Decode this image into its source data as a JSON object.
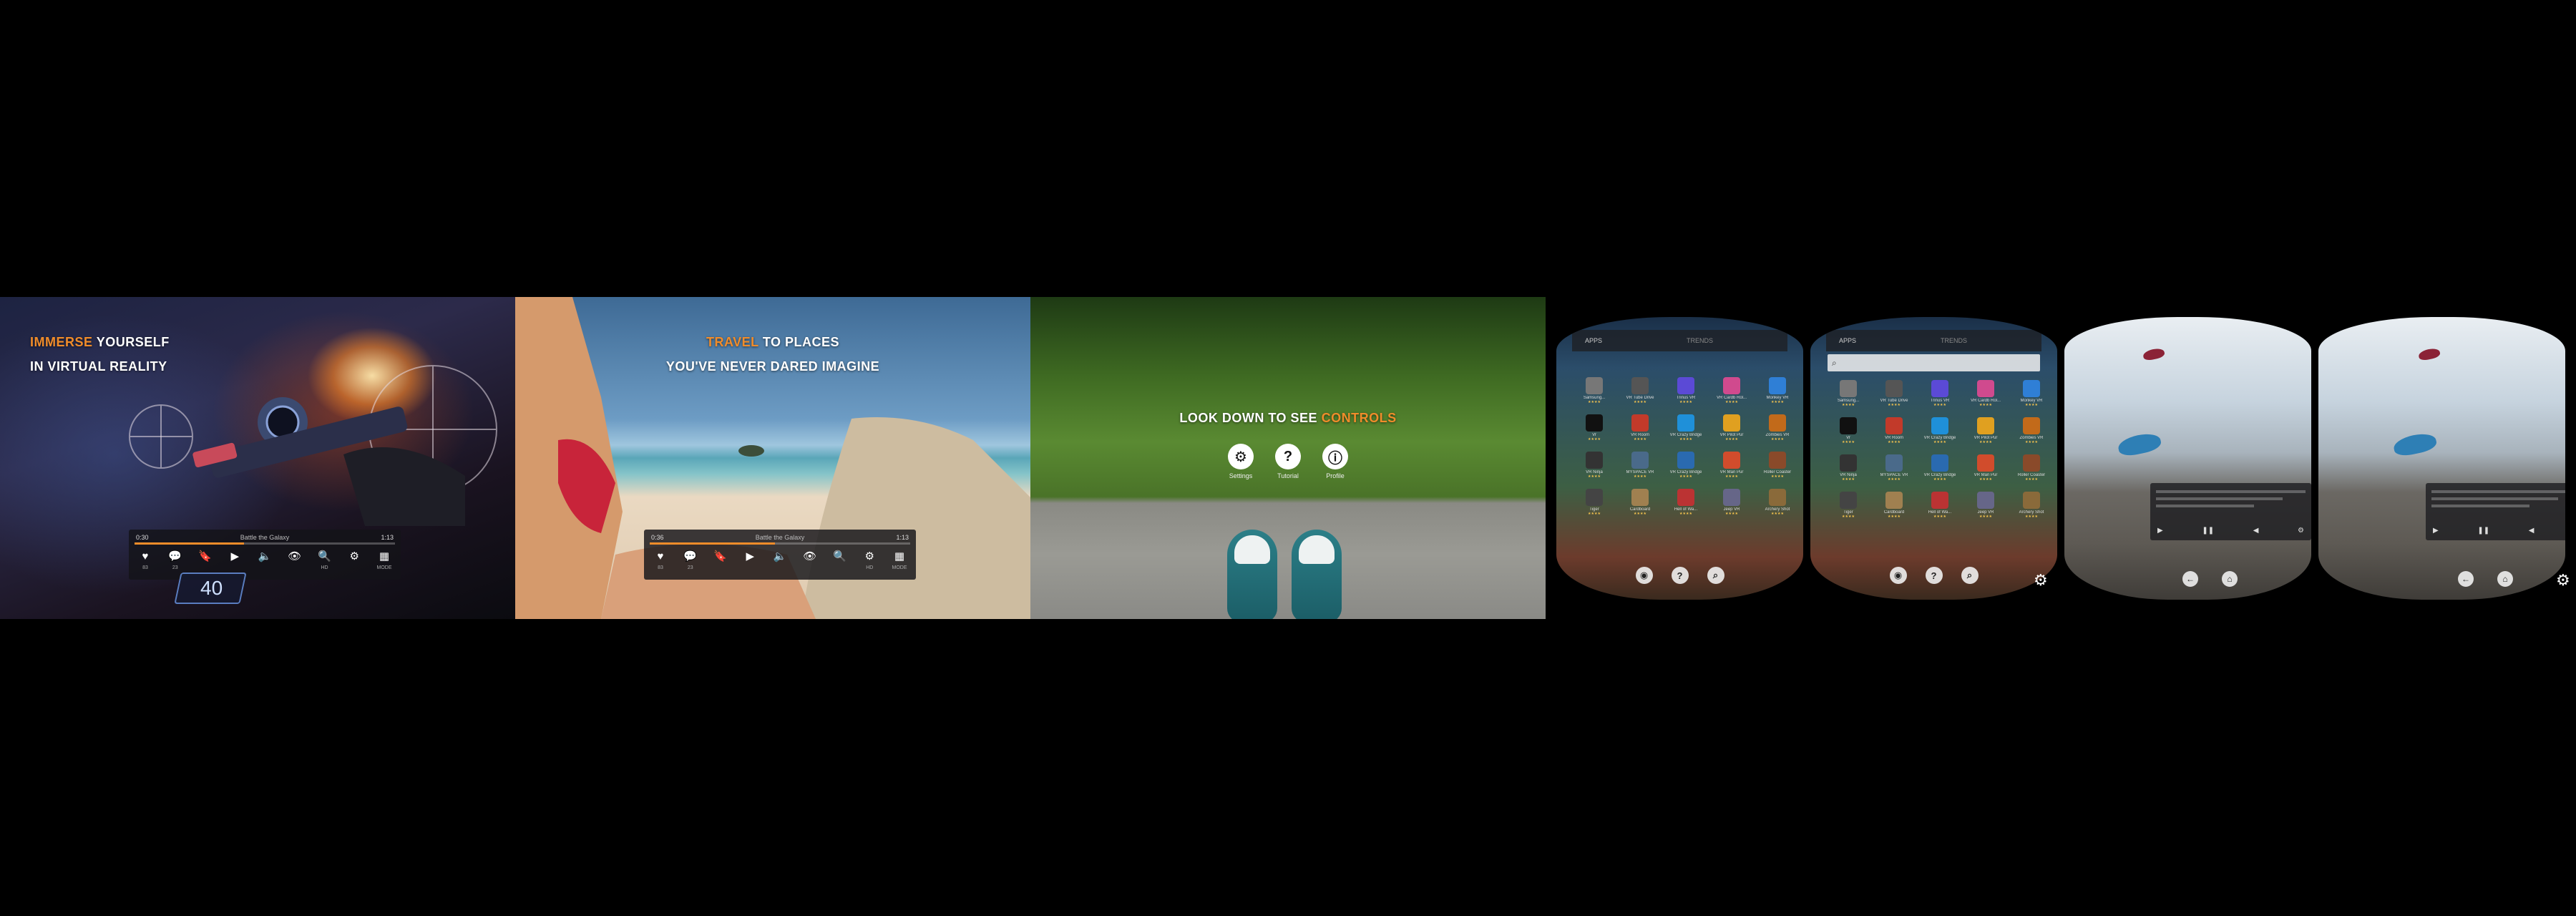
{
  "panel1": {
    "headline": {
      "accent": "IMMERSE",
      "rest": "YOURSELF",
      "line2": "IN VIRTUAL REALITY"
    },
    "player": {
      "time_left": "0:30",
      "title": "Battle the Galaxy",
      "time_right": "1:13",
      "progress": 0.42,
      "controls": [
        {
          "icon": "♥",
          "label": "83",
          "name": "like-icon"
        },
        {
          "icon": "💬",
          "label": "23",
          "name": "comment-icon"
        },
        {
          "icon": "🔖",
          "label": "",
          "name": "bookmark-icon"
        },
        {
          "icon": "▶",
          "label": "",
          "name": "play-icon"
        },
        {
          "icon": "🔈",
          "label": "",
          "name": "volume-icon"
        },
        {
          "icon": "👁",
          "label": "",
          "name": "view-icon"
        },
        {
          "icon": "🔍",
          "label": "HD",
          "name": "zoom-icon"
        },
        {
          "icon": "⚙",
          "label": "",
          "name": "settings-icon"
        },
        {
          "icon": "▦",
          "label": "MODE",
          "name": "mode-icon"
        }
      ]
    },
    "hud_value": "40"
  },
  "panel2": {
    "headline": {
      "accent": "TRAVEL",
      "rest": "TO PLACES",
      "line2": "YOU'VE NEVER DARED IMAGINE"
    },
    "player": {
      "time_left": "0:36",
      "title": "Battle the Galaxy",
      "time_right": "1:13",
      "progress": 0.48,
      "controls": [
        {
          "icon": "♥",
          "label": "83",
          "name": "like-icon"
        },
        {
          "icon": "💬",
          "label": "23",
          "name": "comment-icon"
        },
        {
          "icon": "🔖",
          "label": "",
          "name": "bookmark-icon"
        },
        {
          "icon": "▶",
          "label": "",
          "name": "play-icon"
        },
        {
          "icon": "🔈",
          "label": "",
          "name": "volume-icon"
        },
        {
          "icon": "👁",
          "label": "",
          "name": "view-icon"
        },
        {
          "icon": "🔍",
          "label": "",
          "name": "zoom-icon"
        },
        {
          "icon": "⚙",
          "label": "HD",
          "name": "settings-icon"
        },
        {
          "icon": "▦",
          "label": "MODE",
          "name": "mode-icon"
        }
      ]
    }
  },
  "panel3": {
    "headline": {
      "prefix": "LOOK DOWN TO SEE",
      "accent": "CONTROLS"
    },
    "controls": [
      {
        "icon": "⚙",
        "label": "Settings",
        "name": "settings-icon"
      },
      {
        "icon": "?",
        "label": "Tutorial",
        "name": "help-icon"
      },
      {
        "icon": "ⓘ",
        "label": "Profile",
        "name": "profile-icon"
      }
    ]
  },
  "vr": {
    "header_tab1": "APPS",
    "header_tab2": "TRENDS",
    "apps": [
      {
        "name": "Samsung...",
        "color": "#777"
      },
      {
        "name": "VR Tube Drive",
        "color": "#555"
      },
      {
        "name": "Trinus VR",
        "color": "#5b4ad6"
      },
      {
        "name": "VR Cardb Rol...",
        "color": "#d04a8e"
      },
      {
        "name": "Monkey VR",
        "color": "#2f7fd6"
      },
      {
        "name": "Vr",
        "color": "#111"
      },
      {
        "name": "VR Room",
        "color": "#c23a2a"
      },
      {
        "name": "VR Crazy Bridge",
        "color": "#1f90d9"
      },
      {
        "name": "VR Pilot Pur",
        "color": "#e0a020"
      },
      {
        "name": "Zombies VR",
        "color": "#c26a1a"
      },
      {
        "name": "VR Ninja",
        "color": "#333"
      },
      {
        "name": "MYSPACE VR",
        "color": "#4a6a8a"
      },
      {
        "name": "VR Crazy Bridge",
        "color": "#2a6ab0"
      },
      {
        "name": "VR Man Pur",
        "color": "#d14c2c"
      },
      {
        "name": "Roller Coaster",
        "color": "#8a4a2a"
      },
      {
        "name": "Tiger",
        "color": "#444"
      },
      {
        "name": "Cardboard",
        "color": "#a08050"
      },
      {
        "name": "Hell of Wa...",
        "color": "#b33"
      },
      {
        "name": "Jeep VR",
        "color": "#668"
      },
      {
        "name": "Archery Shot",
        "color": "#8a6a3a"
      }
    ],
    "rating": "★★★★"
  }
}
